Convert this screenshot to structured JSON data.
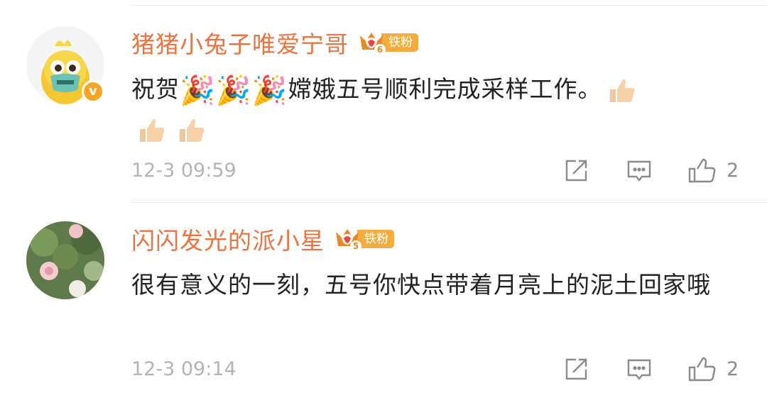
{
  "comments": [
    {
      "username": "猪猪小兔子唯爱宁哥",
      "fan_level": "6",
      "fan_label": "铁粉",
      "verified_icon_text": "v",
      "text_start": "祝贺",
      "text_main": "嫦娥五号顺利完成采样工作。",
      "emoji_party": "🎉",
      "timestamp": "12-3 09:59",
      "likes": "2"
    },
    {
      "username": "闪闪发光的派小星",
      "fan_level": "5",
      "fan_label": "铁粉",
      "text": "很有意义的一刻，五号你快点带着月亮上的泥土回家哦",
      "timestamp": "12-3 09:14",
      "likes": "2"
    }
  ],
  "icons": {
    "share": "share-icon",
    "reply": "comment-icon",
    "like": "thumbs-up-icon",
    "emoji_party": "party-popper-emoji",
    "emoji_thumb": "thumbs-up-emoji"
  },
  "colors": {
    "username": "#eb7340",
    "badge": "#f3ad3f",
    "text": "#222222",
    "meta": "#b3b3b3"
  }
}
